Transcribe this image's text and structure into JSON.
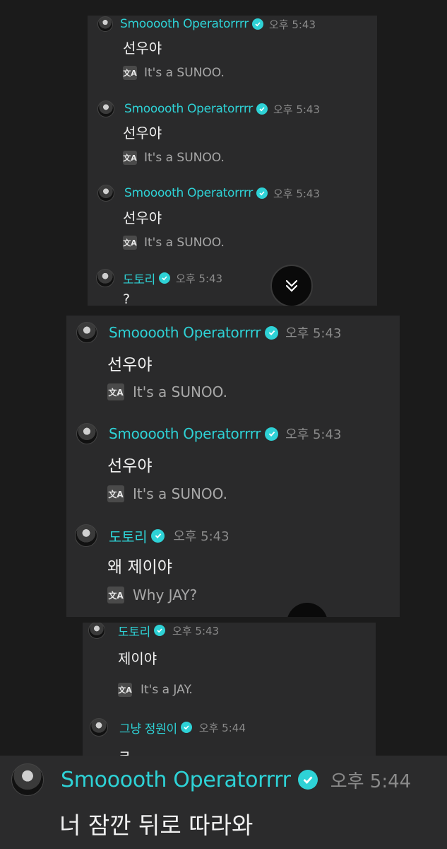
{
  "translate_icon": "translate-icon",
  "verified_icon": "verified-badge-icon",
  "scroll_down_icon": "double-chevron-down-icon",
  "colors": {
    "username": "#2ed2d6",
    "badge": "#2ed2d6",
    "panel": "#2a2a2b",
    "background": "#1b1b1b"
  },
  "section1": {
    "messages": [
      {
        "user": "Smooooth Operatorrrr",
        "time": "오후 5:43",
        "text": "선우야",
        "translation": "It's a SUNOO."
      },
      {
        "user": "Smooooth Operatorrrr",
        "time": "오후 5:43",
        "text": "선우야",
        "translation": "It's a SUNOO."
      },
      {
        "user": "Smooooth Operatorrrr",
        "time": "오후 5:43",
        "text": "선우야",
        "translation": "It's a SUNOO."
      },
      {
        "user": "도토리",
        "time": "오후 5:43",
        "text": "?"
      }
    ]
  },
  "section2": {
    "messages": [
      {
        "user": "Smooooth Operatorrrr",
        "time": "오후 5:43",
        "text": "선우야",
        "translation": "It's a SUNOO."
      },
      {
        "user": "Smooooth Operatorrrr",
        "time": "오후 5:43",
        "text": "선우야",
        "translation": "It's a SUNOO."
      },
      {
        "user": "도토리",
        "time": "오후 5:43",
        "text": "왜 제이야",
        "translation": "Why JAY?"
      }
    ]
  },
  "section3": {
    "messages": [
      {
        "user": "도토리",
        "time": "오후 5:43",
        "text": "제이야",
        "translation": "It's a JAY."
      },
      {
        "user": "그냥 정원이",
        "time": "오후 5:44",
        "text": "ㅋ"
      }
    ]
  },
  "section4": {
    "messages": [
      {
        "user": "Smooooth Operatorrrr",
        "time": "오후 5:44",
        "text": "너 잠깐 뒤로 따라와"
      }
    ]
  }
}
